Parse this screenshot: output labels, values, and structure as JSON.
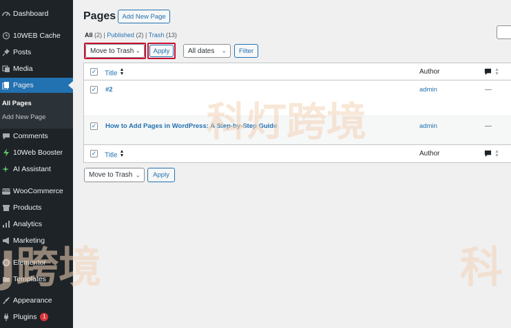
{
  "sidebar": {
    "items": [
      {
        "label": "Dashboard",
        "icon": "dashboard-icon"
      },
      {
        "label": "10WEB Cache",
        "icon": "cache-icon"
      },
      {
        "label": "Posts",
        "icon": "pin-icon"
      },
      {
        "label": "Media",
        "icon": "media-icon"
      },
      {
        "label": "Pages",
        "icon": "pages-icon"
      },
      {
        "label": "Comments",
        "icon": "comment-bubble-icon"
      },
      {
        "label": "10Web Booster",
        "icon": "booster-icon"
      },
      {
        "label": "AI Assistant",
        "icon": "sparkle-icon"
      },
      {
        "label": "WooCommerce",
        "icon": "woo-icon"
      },
      {
        "label": "Products",
        "icon": "archive-icon"
      },
      {
        "label": "Analytics",
        "icon": "bar-chart-icon"
      },
      {
        "label": "Marketing",
        "icon": "megaphone-icon"
      },
      {
        "label": "Elementor",
        "icon": "elementor-icon"
      },
      {
        "label": "Templates",
        "icon": "folder-icon"
      },
      {
        "label": "Appearance",
        "icon": "brush-icon"
      },
      {
        "label": "Plugins",
        "icon": "plug-icon",
        "badge": "1"
      }
    ],
    "submenu": {
      "all_pages": "All Pages",
      "add_new_page": "Add New Page"
    },
    "woo_mark": "WOO"
  },
  "header": {
    "title": "Pages",
    "add_new": "Add New Page"
  },
  "views": {
    "all": "All",
    "all_count": "(2)",
    "published": "Published",
    "published_count": "(2)",
    "trash": "Trash",
    "trash_count": "(13)",
    "sep": "|"
  },
  "bulk_top": {
    "action": "Move to Trash",
    "apply": "Apply",
    "dates": "All dates",
    "filter": "Filter"
  },
  "table": {
    "columns": {
      "title": "Title",
      "author": "Author"
    },
    "rows": [
      {
        "title": "#2",
        "author": "admin",
        "comments": "—",
        "checked": true
      },
      {
        "title": "How to Add Pages in WordPress: A Step-by-Step Guide",
        "author": "admin",
        "comments": "—",
        "checked": true
      }
    ]
  },
  "bulk_bottom": {
    "action": "Move to Trash",
    "apply": "Apply"
  },
  "watermark": {
    "text1": "科灯跨境",
    "text2": "J跨境",
    "text3": "科"
  },
  "colors": {
    "accent": "#2271b1",
    "highlight": "#c8102e",
    "sidebar": "#1d2327"
  }
}
